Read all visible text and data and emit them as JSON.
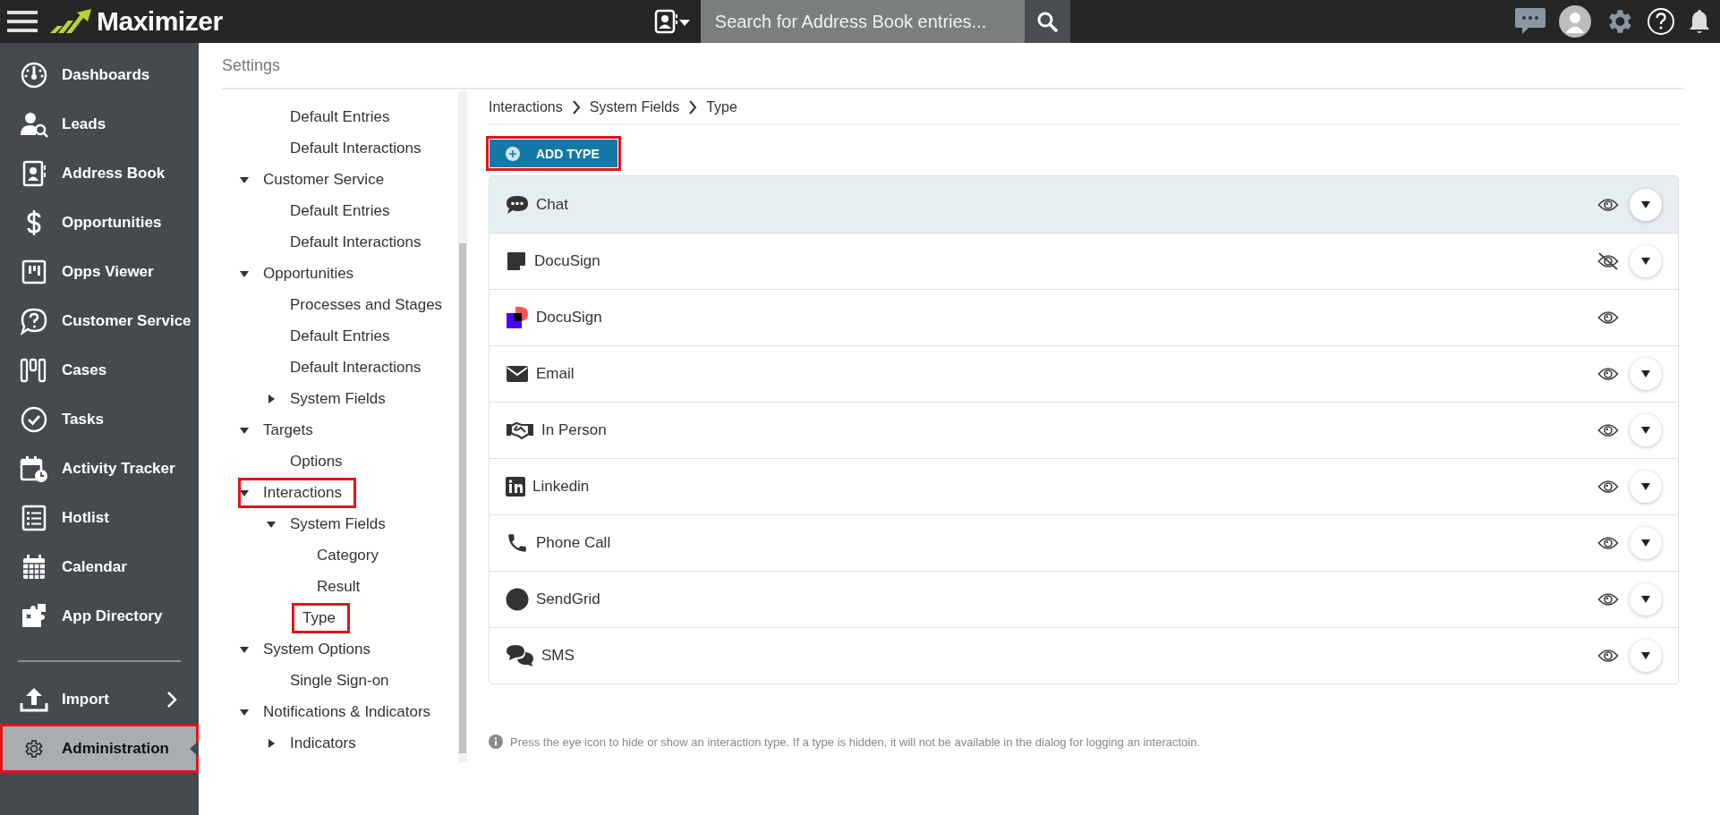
{
  "topbar": {
    "brand": "Maximizer",
    "search": {
      "placeholder": "Search for Address Book entries..."
    }
  },
  "sidebar": {
    "items": [
      {
        "label": "Dashboards",
        "selected": false,
        "highlighted": false
      },
      {
        "label": "Leads",
        "selected": false,
        "highlighted": false
      },
      {
        "label": "Address Book",
        "selected": false,
        "highlighted": false
      },
      {
        "label": "Opportunities",
        "selected": false,
        "highlighted": false
      },
      {
        "label": "Opps Viewer",
        "selected": false,
        "highlighted": false
      },
      {
        "label": "Customer Service",
        "selected": false,
        "highlighted": false
      },
      {
        "label": "Cases",
        "selected": false,
        "highlighted": false
      },
      {
        "label": "Tasks",
        "selected": false,
        "highlighted": false
      },
      {
        "label": "Activity Tracker",
        "selected": false,
        "highlighted": false
      },
      {
        "label": "Hotlist",
        "selected": false,
        "highlighted": false
      },
      {
        "label": "Calendar",
        "selected": false,
        "highlighted": false
      },
      {
        "label": "App Directory",
        "selected": false,
        "highlighted": false
      }
    ],
    "footer_items": [
      {
        "label": "Import",
        "submenu": true,
        "selected": false,
        "highlighted": false
      },
      {
        "label": "Administration",
        "submenu": false,
        "selected": true,
        "highlighted": true
      }
    ]
  },
  "settings": {
    "title": "Settings",
    "tree": [
      {
        "kind": "continued",
        "children": [
          {
            "kind": "leaf",
            "label": "Default Entries",
            "highlighted": false
          },
          {
            "kind": "leaf",
            "label": "Default Interactions",
            "highlighted": false
          }
        ]
      },
      {
        "kind": "folder",
        "label": "Customer Service",
        "expanded": true,
        "highlighted": false,
        "children": [
          {
            "kind": "leaf",
            "label": "Default Entries",
            "highlighted": false
          },
          {
            "kind": "leaf",
            "label": "Default Interactions",
            "highlighted": false
          }
        ]
      },
      {
        "kind": "folder",
        "label": "Opportunities",
        "expanded": true,
        "highlighted": false,
        "children": [
          {
            "kind": "leaf",
            "label": "Processes and Stages",
            "highlighted": false
          },
          {
            "kind": "leaf",
            "label": "Default Entries",
            "highlighted": false
          },
          {
            "kind": "leaf",
            "label": "Default Interactions",
            "highlighted": false
          },
          {
            "kind": "folder",
            "label": "System Fields",
            "expanded": false,
            "highlighted": false
          }
        ]
      },
      {
        "kind": "folder",
        "label": "Targets",
        "expanded": true,
        "highlighted": false,
        "children": [
          {
            "kind": "leaf",
            "label": "Options",
            "highlighted": false
          }
        ]
      },
      {
        "kind": "folder",
        "label": "Interactions",
        "expanded": true,
        "highlighted": true,
        "children": [
          {
            "kind": "folder",
            "label": "System Fields",
            "expanded": true,
            "highlighted": false,
            "children": [
              {
                "kind": "leaf",
                "label": "Category",
                "highlighted": false
              },
              {
                "kind": "leaf",
                "label": "Result",
                "highlighted": false
              },
              {
                "kind": "leaf",
                "label": "Type",
                "highlighted": true
              }
            ]
          }
        ]
      },
      {
        "kind": "folder",
        "label": "System Options",
        "expanded": true,
        "highlighted": false,
        "children": [
          {
            "kind": "leaf",
            "label": "Single Sign-on",
            "highlighted": false
          }
        ]
      },
      {
        "kind": "folder",
        "label": "Notifications & Indicators",
        "expanded": true,
        "highlighted": false,
        "children": [
          {
            "kind": "folder",
            "label": "Indicators",
            "expanded": false,
            "highlighted": false
          }
        ]
      }
    ],
    "breadcrumb": [
      "Interactions",
      "System Fields",
      "Type"
    ],
    "add_button": {
      "label": "ADD TYPE",
      "highlighted": true
    },
    "types": [
      {
        "label": "Chat",
        "selected": true,
        "visible": true,
        "has_menu": true
      },
      {
        "label": "DocuSign",
        "selected": false,
        "visible": false,
        "has_menu": true
      },
      {
        "label": "DocuSign",
        "selected": false,
        "visible": true,
        "has_menu": false
      },
      {
        "label": "Email",
        "selected": false,
        "visible": true,
        "has_menu": true
      },
      {
        "label": "In Person",
        "selected": false,
        "visible": true,
        "has_menu": true
      },
      {
        "label": "Linkedin",
        "selected": false,
        "visible": true,
        "has_menu": true
      },
      {
        "label": "Phone Call",
        "selected": false,
        "visible": true,
        "has_menu": true
      },
      {
        "label": "SendGrid",
        "selected": false,
        "visible": true,
        "has_menu": true
      },
      {
        "label": "SMS",
        "selected": false,
        "visible": true,
        "has_menu": true
      }
    ],
    "note": "Press the eye icon to hide or show an interaction type. If a type is hidden, it will not be available in the dialog for logging an interactoin."
  }
}
